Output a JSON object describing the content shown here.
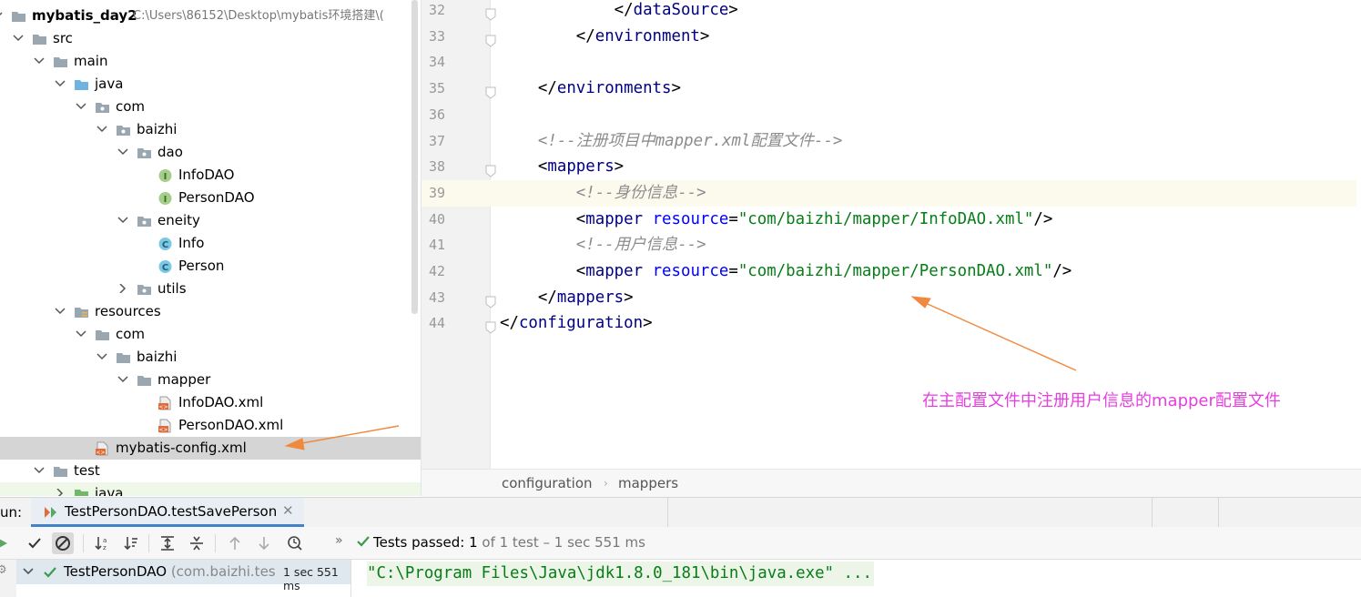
{
  "tree": {
    "project_name": "mybatis_day2",
    "project_path": "C:\\Users\\86152\\Desktop\\mybatis环境搭建\\(",
    "items": [
      {
        "label": "src",
        "icon": "folder-icon",
        "expanded": true
      },
      {
        "label": "main",
        "icon": "folder-icon",
        "expanded": true
      },
      {
        "label": "java",
        "icon": "source-folder-icon",
        "expanded": true
      },
      {
        "label": "com",
        "icon": "package-icon",
        "expanded": true
      },
      {
        "label": "baizhi",
        "icon": "package-icon",
        "expanded": true
      },
      {
        "label": "dao",
        "icon": "package-icon",
        "expanded": true
      },
      {
        "label": "InfoDAO",
        "icon": "interface-icon"
      },
      {
        "label": "PersonDAO",
        "icon": "interface-icon"
      },
      {
        "label": "eneity",
        "icon": "package-icon",
        "expanded": true
      },
      {
        "label": "Info",
        "icon": "class-icon"
      },
      {
        "label": "Person",
        "icon": "class-icon"
      },
      {
        "label": "utils",
        "icon": "package-icon",
        "expanded": false
      },
      {
        "label": "resources",
        "icon": "resources-folder-icon",
        "expanded": true
      },
      {
        "label": "com",
        "icon": "folder-icon",
        "expanded": true
      },
      {
        "label": "baizhi",
        "icon": "folder-icon",
        "expanded": true
      },
      {
        "label": "mapper",
        "icon": "folder-icon",
        "expanded": true
      },
      {
        "label": "InfoDAO.xml",
        "icon": "xml-file-icon"
      },
      {
        "label": "PersonDAO.xml",
        "icon": "xml-file-icon"
      },
      {
        "label": "mybatis-config.xml",
        "icon": "xml-file-icon",
        "selected": true
      },
      {
        "label": "test",
        "icon": "folder-icon",
        "expanded": true
      },
      {
        "label": "java",
        "icon": "test-source-folder-icon",
        "expanded": false
      }
    ]
  },
  "editor": {
    "current_line": "39",
    "lines": [
      {
        "num": "32",
        "text": "            </dataSource>"
      },
      {
        "num": "33",
        "text": "        </environment>"
      },
      {
        "num": "34",
        "text": ""
      },
      {
        "num": "35",
        "text": "    </environments>"
      },
      {
        "num": "36",
        "text": ""
      },
      {
        "num": "37",
        "text": "    <!--注册项目中mapper.xml配置文件-->"
      },
      {
        "num": "38",
        "text": "    <mappers>"
      },
      {
        "num": "39",
        "text": "        <!--身份信息-->"
      },
      {
        "num": "40",
        "text": "        <mapper resource=\"com/baizhi/mapper/InfoDAO.xml\"/>"
      },
      {
        "num": "41",
        "text": "        <!--用户信息-->"
      },
      {
        "num": "42",
        "text": "        <mapper resource=\"com/baizhi/mapper/PersonDAO.xml\"/>"
      },
      {
        "num": "43",
        "text": "    </mappers>"
      },
      {
        "num": "44",
        "text": "</configuration>"
      }
    ],
    "breadcrumb": [
      "configuration",
      "mappers"
    ],
    "annotation": "在主配置文件中注册用户信息的mapper配置文件",
    "annotation_color": "#e63fe0",
    "arrow_color": "#f0883e"
  },
  "run": {
    "label": "un:",
    "tab_title": "TestPersonDAO.testSavePerson",
    "tests_passed_label": "Tests passed:",
    "tests_passed_value": "1",
    "tests_passed_detail": "of 1 test – 1 sec 551 ms",
    "test_name": "TestPersonDAO",
    "test_package": "(com.baizhi.tes",
    "test_time": "1 sec 551 ms",
    "console_line": "\"C:\\Program Files\\Java\\jdk1.8.0_181\\bin\\java.exe\" ..."
  }
}
